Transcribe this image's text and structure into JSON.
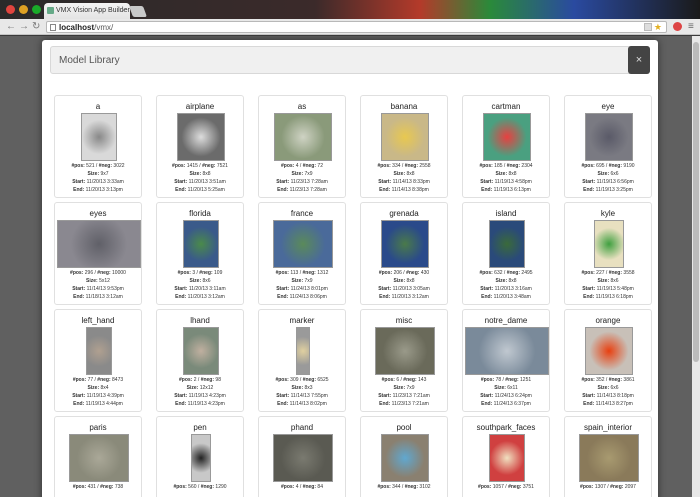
{
  "browser": {
    "tab_title": "VMX Vision App Builder",
    "url_host": "localhost",
    "url_path": "/vmx/"
  },
  "modal": {
    "title": "Model Library",
    "close_label": "×"
  },
  "labels": {
    "pos": "#pos:",
    "neg": "#neg:",
    "size": "Size:",
    "start": "Start:",
    "end": "End:"
  },
  "models": [
    {
      "name": "a",
      "pos": "521",
      "neg": "3022",
      "size": "9x7",
      "start": "11/20/13 3:33am",
      "end": "11/20/13 3:13pm",
      "thumb": "#d9d9d9",
      "thumb2": "#888"
    },
    {
      "name": "airplane",
      "pos": "1415",
      "neg": "7521",
      "size": "8x8",
      "start": "11/20/13 3:51am",
      "end": "11/20/13 5:25am",
      "thumb": "#6b6b6b",
      "thumb2": "#ddd"
    },
    {
      "name": "as",
      "pos": "4",
      "neg": "72",
      "size": "7x9",
      "start": "11/23/13 7:28am",
      "end": "11/23/13 7:28am",
      "thumb": "#8a9a7a",
      "thumb2": "#cfd3c4"
    },
    {
      "name": "banana",
      "pos": "334",
      "neg": "2558",
      "size": "8x8",
      "start": "11/14/13 8:33pm",
      "end": "11/14/13 8:38pm",
      "thumb": "#c9b888",
      "thumb2": "#e8c850"
    },
    {
      "name": "cartman",
      "pos": "185",
      "neg": "2304",
      "size": "8x8",
      "start": "11/19/13 4:58pm",
      "end": "11/19/13 6:13pm",
      "thumb": "#4aa080",
      "thumb2": "#e84040"
    },
    {
      "name": "eye",
      "pos": "695",
      "neg": "9190",
      "size": "6x6",
      "start": "11/19/13 6:56pm",
      "end": "11/19/13 3:25pm",
      "thumb": "#7a7a82",
      "thumb2": "#5a5a68"
    },
    {
      "name": "eyes",
      "pos": "296",
      "neg": "10000",
      "size": "5x12",
      "start": "11/14/13 9:53pm",
      "end": "11/18/13 3:12am",
      "thumb": "#8a8890",
      "thumb2": "#606068"
    },
    {
      "name": "florida",
      "pos": "3",
      "neg": "109",
      "size": "8x6",
      "start": "11/20/13 3:11am",
      "end": "11/20/13 3:12am",
      "thumb": "#3a5a8a",
      "thumb2": "#4a8a4a"
    },
    {
      "name": "france",
      "pos": "113",
      "neg": "1312",
      "size": "7x9",
      "start": "11/24/13 8:01pm",
      "end": "11/24/13 8:06pm",
      "thumb": "#4a6a9a",
      "thumb2": "#5a8a5a"
    },
    {
      "name": "grenada",
      "pos": "206",
      "neg": "430",
      "size": "8x8",
      "start": "11/20/13 3:05am",
      "end": "11/20/13 3:12am",
      "thumb": "#2a4a8a",
      "thumb2": "#4a7a4a"
    },
    {
      "name": "island",
      "pos": "632",
      "neg": "2495",
      "size": "8x8",
      "start": "11/20/13 3:16am",
      "end": "11/20/13 3:48am",
      "thumb": "#2a4a7a",
      "thumb2": "#3a6a3a"
    },
    {
      "name": "kyle",
      "pos": "227",
      "neg": "3558",
      "size": "8x6",
      "start": "11/19/13 5:48pm",
      "end": "11/19/13 6:18pm",
      "thumb": "#e8e0c0",
      "thumb2": "#40a040"
    },
    {
      "name": "left_hand",
      "pos": "77",
      "neg": "8473",
      "size": "8x4",
      "start": "11/19/13 4:39pm",
      "end": "11/19/13 4:44pm",
      "thumb": "#8a8a8a",
      "thumb2": "#b0a090"
    },
    {
      "name": "lhand",
      "pos": "2",
      "neg": "98",
      "size": "12x12",
      "start": "11/19/13 4:23pm",
      "end": "11/19/13 4:23pm",
      "thumb": "#7a8a7a",
      "thumb2": "#c0b0a0"
    },
    {
      "name": "marker",
      "pos": "309",
      "neg": "6525",
      "size": "8x3",
      "start": "11/14/13 7:55pm",
      "end": "11/14/13 8:02pm",
      "thumb": "#9a9a9a",
      "thumb2": "#e0d0a0"
    },
    {
      "name": "misc",
      "pos": "6",
      "neg": "143",
      "size": "7x9",
      "start": "11/23/13 7:21am",
      "end": "11/23/13 7:21am",
      "thumb": "#6a6a5a",
      "thumb2": "#9a9a8a"
    },
    {
      "name": "notre_dame",
      "pos": "78",
      "neg": "1251",
      "size": "6x11",
      "start": "11/24/13 6:24pm",
      "end": "11/24/13 6:37pm",
      "thumb": "#7a8a9a",
      "thumb2": "#c0c8d0"
    },
    {
      "name": "orange",
      "pos": "352",
      "neg": "3861",
      "size": "6x6",
      "start": "11/14/13 8:18pm",
      "end": "11/14/13 8:27pm",
      "thumb": "#c8c0b8",
      "thumb2": "#e84010"
    },
    {
      "name": "paris",
      "pos": "431",
      "neg": "738",
      "size": "",
      "start": "",
      "end": "",
      "thumb": "#8a8a7a",
      "thumb2": "#aaa898"
    },
    {
      "name": "pen",
      "pos": "560",
      "neg": "1290",
      "size": "",
      "start": "",
      "end": "",
      "thumb": "#c8c8c8",
      "thumb2": "#222"
    },
    {
      "name": "phand",
      "pos": "4",
      "neg": "84",
      "size": "",
      "start": "",
      "end": "",
      "thumb": "#5a5a52",
      "thumb2": "#7a7a70"
    },
    {
      "name": "pool",
      "pos": "344",
      "neg": "3102",
      "size": "",
      "start": "",
      "end": "",
      "thumb": "#8a8070",
      "thumb2": "#60a8d0"
    },
    {
      "name": "southpark_faces",
      "pos": "1057",
      "neg": "3751",
      "size": "",
      "start": "",
      "end": "",
      "thumb": "#d04040",
      "thumb2": "#f0e0c0"
    },
    {
      "name": "spain_interior",
      "pos": "1307",
      "neg": "2097",
      "size": "",
      "start": "",
      "end": "",
      "thumb": "#8a7a5a",
      "thumb2": "#a89a70"
    }
  ]
}
